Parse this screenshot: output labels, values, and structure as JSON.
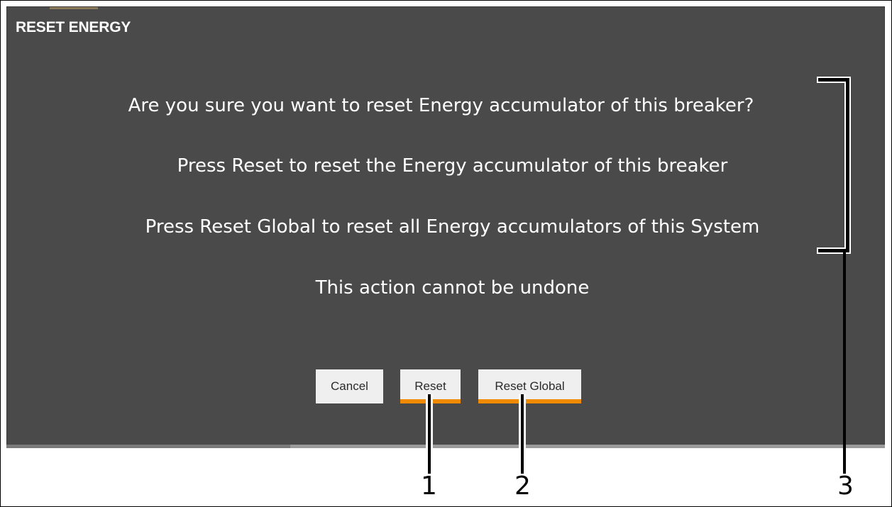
{
  "dialog": {
    "title": "RESET ENERGY",
    "lines": [
      "Are you sure you want to reset Energy accumulator of this breaker?",
      "Press Reset to reset the Energy accumulator of this breaker",
      "Press Reset Global to reset all Energy accumulators of this System",
      "This action cannot be undone"
    ],
    "buttons": {
      "cancel": "Cancel",
      "reset": "Reset",
      "reset_global": "Reset Global"
    }
  },
  "callouts": {
    "one": "1",
    "two": "2",
    "three": "3"
  },
  "colors": {
    "dialog_bg": "#4a4a4a",
    "button_bg": "#efefef",
    "accent": "#f08a00",
    "text": "#ffffff"
  }
}
